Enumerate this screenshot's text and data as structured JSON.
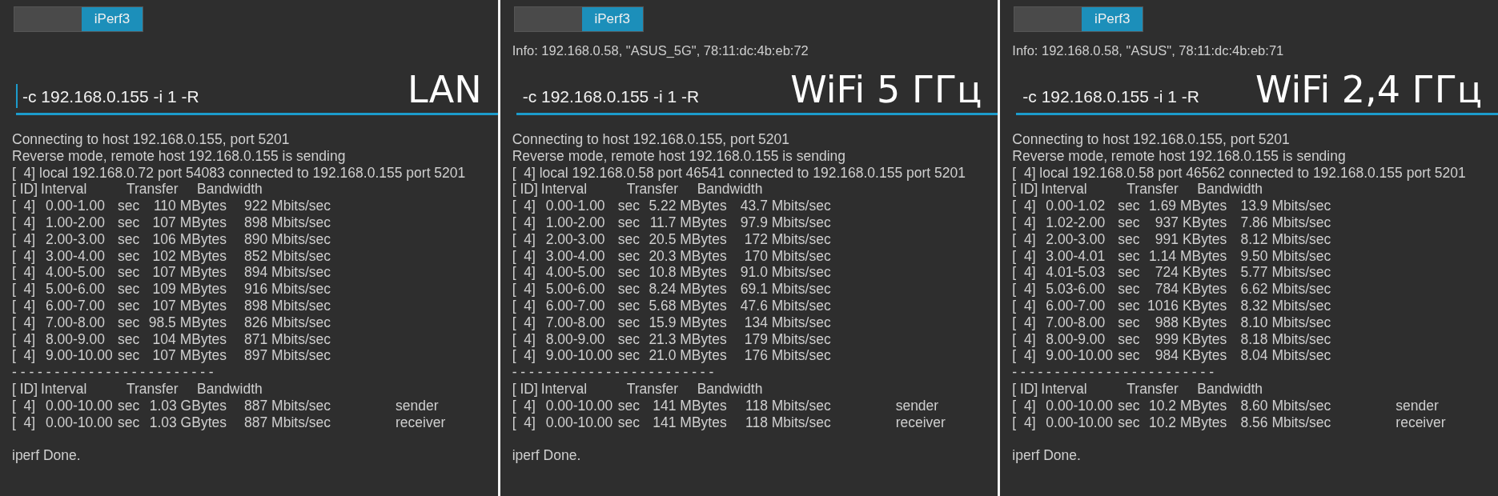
{
  "panels": [
    {
      "tab": {
        "label": "iPerf3",
        "selected": true
      },
      "command": {
        "value": "-c 192.168.0.155 -i 1 -R",
        "focused": true
      },
      "caption": "LAN",
      "output": {
        "lines": [
          "Connecting to host 192.168.0.155, port 5201",
          "Reverse mode, remote host 192.168.0.155 is sending",
          "[  4] local 192.168.0.72 port 54083 connected to 192.168.0.155 port 5201"
        ],
        "header": {
          "id": "[ ID]",
          "interval": "Interval",
          "transfer": "Transfer",
          "bandwidth": "Bandwidth"
        },
        "rows": [
          {
            "id": "[  4]",
            "interval": "0.00-1.00",
            "unit": "sec",
            "transfer": "110 MBytes",
            "bandwidth": "922 Mbits/sec"
          },
          {
            "id": "[  4]",
            "interval": "1.00-2.00",
            "unit": "sec",
            "transfer": "107 MBytes",
            "bandwidth": "898 Mbits/sec"
          },
          {
            "id": "[  4]",
            "interval": "2.00-3.00",
            "unit": "sec",
            "transfer": "106 MBytes",
            "bandwidth": "890 Mbits/sec"
          },
          {
            "id": "[  4]",
            "interval": "3.00-4.00",
            "unit": "sec",
            "transfer": "102 MBytes",
            "bandwidth": "852 Mbits/sec"
          },
          {
            "id": "[  4]",
            "interval": "4.00-5.00",
            "unit": "sec",
            "transfer": "107 MBytes",
            "bandwidth": "894 Mbits/sec"
          },
          {
            "id": "[  4]",
            "interval": "5.00-6.00",
            "unit": "sec",
            "transfer": "109 MBytes",
            "bandwidth": "916 Mbits/sec"
          },
          {
            "id": "[  4]",
            "interval": "6.00-7.00",
            "unit": "sec",
            "transfer": "107 MBytes",
            "bandwidth": "898 Mbits/sec"
          },
          {
            "id": "[  4]",
            "interval": "7.00-8.00",
            "unit": "sec",
            "transfer": "98.5 MBytes",
            "bandwidth": "826 Mbits/sec"
          },
          {
            "id": "[  4]",
            "interval": "8.00-9.00",
            "unit": "sec",
            "transfer": "104 MBytes",
            "bandwidth": "871 Mbits/sec"
          },
          {
            "id": "[  4]",
            "interval": "9.00-10.00",
            "unit": "sec",
            "transfer": "107 MBytes",
            "bandwidth": "897 Mbits/sec"
          }
        ],
        "separator": "- - - - - - - - - - - - - - - - - - - - - - - -",
        "summary_header": {
          "id": "[ ID]",
          "interval": "Interval",
          "transfer": "Transfer",
          "bandwidth": "Bandwidth"
        },
        "summary": [
          {
            "id": "[  4]",
            "interval": "0.00-10.00",
            "unit": "sec",
            "transfer": "1.03 GBytes",
            "bandwidth": "887 Mbits/sec",
            "role": "sender"
          },
          {
            "id": "[  4]",
            "interval": "0.00-10.00",
            "unit": "sec",
            "transfer": "1.03 GBytes",
            "bandwidth": "887 Mbits/sec",
            "role": "receiver"
          }
        ],
        "done": "iperf Done."
      }
    },
    {
      "tab": {
        "label": "iPerf3",
        "selected": true
      },
      "info": "Info: 192.168.0.58, \"ASUS_5G\", 78:11:dc:4b:eb:72",
      "command": {
        "value": "-c 192.168.0.155 -i 1 -R",
        "focused": false
      },
      "caption": "WiFi 5 ГГц",
      "output": {
        "lines": [
          "Connecting to host 192.168.0.155, port 5201",
          "Reverse mode, remote host 192.168.0.155 is sending",
          "[  4] local 192.168.0.58 port 46541 connected to 192.168.0.155 port 5201"
        ],
        "header": {
          "id": "[ ID]",
          "interval": "Interval",
          "transfer": "Transfer",
          "bandwidth": "Bandwidth"
        },
        "rows": [
          {
            "id": "[  4]",
            "interval": "0.00-1.00",
            "unit": "sec",
            "transfer": "5.22 MBytes",
            "bandwidth": "43.7 Mbits/sec"
          },
          {
            "id": "[  4]",
            "interval": "1.00-2.00",
            "unit": "sec",
            "transfer": "11.7 MBytes",
            "bandwidth": "97.9 Mbits/sec"
          },
          {
            "id": "[  4]",
            "interval": "2.00-3.00",
            "unit": "sec",
            "transfer": "20.5 MBytes",
            "bandwidth": "172 Mbits/sec"
          },
          {
            "id": "[  4]",
            "interval": "3.00-4.00",
            "unit": "sec",
            "transfer": "20.3 MBytes",
            "bandwidth": "170 Mbits/sec"
          },
          {
            "id": "[  4]",
            "interval": "4.00-5.00",
            "unit": "sec",
            "transfer": "10.8 MBytes",
            "bandwidth": "91.0 Mbits/sec"
          },
          {
            "id": "[  4]",
            "interval": "5.00-6.00",
            "unit": "sec",
            "transfer": "8.24 MBytes",
            "bandwidth": "69.1 Mbits/sec"
          },
          {
            "id": "[  4]",
            "interval": "6.00-7.00",
            "unit": "sec",
            "transfer": "5.68 MBytes",
            "bandwidth": "47.6 Mbits/sec"
          },
          {
            "id": "[  4]",
            "interval": "7.00-8.00",
            "unit": "sec",
            "transfer": "15.9 MBytes",
            "bandwidth": "134 Mbits/sec"
          },
          {
            "id": "[  4]",
            "interval": "8.00-9.00",
            "unit": "sec",
            "transfer": "21.3 MBytes",
            "bandwidth": "179 Mbits/sec"
          },
          {
            "id": "[  4]",
            "interval": "9.00-10.00",
            "unit": "sec",
            "transfer": "21.0 MBytes",
            "bandwidth": "176 Mbits/sec"
          }
        ],
        "separator": "- - - - - - - - - - - - - - - - - - - - - - - -",
        "summary_header": {
          "id": "[ ID]",
          "interval": "Interval",
          "transfer": "Transfer",
          "bandwidth": "Bandwidth"
        },
        "summary": [
          {
            "id": "[  4]",
            "interval": "0.00-10.00",
            "unit": "sec",
            "transfer": "141 MBytes",
            "bandwidth": "118 Mbits/sec",
            "role": "sender"
          },
          {
            "id": "[  4]",
            "interval": "0.00-10.00",
            "unit": "sec",
            "transfer": "141 MBytes",
            "bandwidth": "118 Mbits/sec",
            "role": "receiver"
          }
        ],
        "done": "iperf Done."
      }
    },
    {
      "tab": {
        "label": "iPerf3",
        "selected": true
      },
      "info": "Info: 192.168.0.58, \"ASUS\", 78:11:dc:4b:eb:71",
      "command": {
        "value": "-c 192.168.0.155 -i 1 -R",
        "focused": false
      },
      "caption": "WiFi 2,4 ГГц",
      "output": {
        "lines": [
          "Connecting to host 192.168.0.155, port 5201",
          "Reverse mode, remote host 192.168.0.155 is sending",
          "[  4] local 192.168.0.58 port 46562 connected to 192.168.0.155 port 5201"
        ],
        "header": {
          "id": "[ ID]",
          "interval": "Interval",
          "transfer": "Transfer",
          "bandwidth": "Bandwidth"
        },
        "rows": [
          {
            "id": "[  4]",
            "interval": "0.00-1.02",
            "unit": "sec",
            "transfer": "1.69 MBytes",
            "bandwidth": "13.9 Mbits/sec"
          },
          {
            "id": "[  4]",
            "interval": "1.02-2.00",
            "unit": "sec",
            "transfer": "937 KBytes",
            "bandwidth": "7.86 Mbits/sec"
          },
          {
            "id": "[  4]",
            "interval": "2.00-3.00",
            "unit": "sec",
            "transfer": "991 KBytes",
            "bandwidth": "8.12 Mbits/sec"
          },
          {
            "id": "[  4]",
            "interval": "3.00-4.01",
            "unit": "sec",
            "transfer": "1.14 MBytes",
            "bandwidth": "9.50 Mbits/sec"
          },
          {
            "id": "[  4]",
            "interval": "4.01-5.03",
            "unit": "sec",
            "transfer": "724 KBytes",
            "bandwidth": "5.77 Mbits/sec"
          },
          {
            "id": "[  4]",
            "interval": "5.03-6.00",
            "unit": "sec",
            "transfer": "784 KBytes",
            "bandwidth": "6.62 Mbits/sec"
          },
          {
            "id": "[  4]",
            "interval": "6.00-7.00",
            "unit": "sec",
            "transfer": "1016 KBytes",
            "bandwidth": "8.32 Mbits/sec"
          },
          {
            "id": "[  4]",
            "interval": "7.00-8.00",
            "unit": "sec",
            "transfer": "988 KBytes",
            "bandwidth": "8.10 Mbits/sec"
          },
          {
            "id": "[  4]",
            "interval": "8.00-9.00",
            "unit": "sec",
            "transfer": "999 KBytes",
            "bandwidth": "8.18 Mbits/sec"
          },
          {
            "id": "[  4]",
            "interval": "9.00-10.00",
            "unit": "sec",
            "transfer": "984 KBytes",
            "bandwidth": "8.04 Mbits/sec"
          }
        ],
        "separator": "- - - - - - - - - - - - - - - - - - - - - - - -",
        "summary_header": {
          "id": "[ ID]",
          "interval": "Interval",
          "transfer": "Transfer",
          "bandwidth": "Bandwidth"
        },
        "summary": [
          {
            "id": "[  4]",
            "interval": "0.00-10.00",
            "unit": "sec",
            "transfer": "10.2 MBytes",
            "bandwidth": "8.60 Mbits/sec",
            "role": "sender"
          },
          {
            "id": "[  4]",
            "interval": "0.00-10.00",
            "unit": "sec",
            "transfer": "10.2 MBytes",
            "bandwidth": "8.56 Mbits/sec",
            "role": "receiver"
          }
        ],
        "done": "iperf Done."
      }
    }
  ]
}
